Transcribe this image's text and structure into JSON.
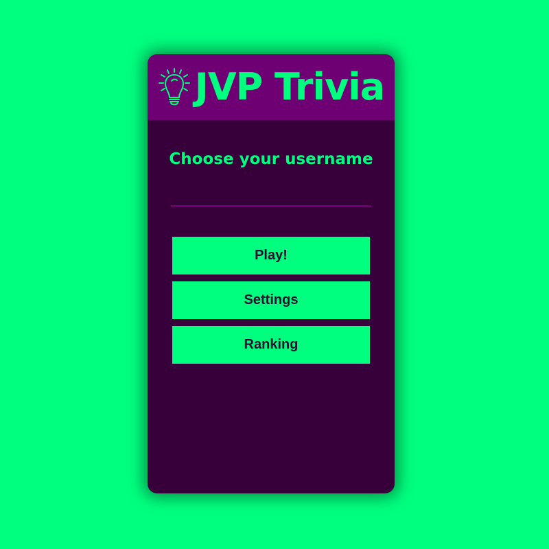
{
  "app": {
    "title": "JVP Trivia",
    "logo_icon": "lightbulb-icon"
  },
  "login": {
    "prompt": "Choose your username",
    "username_value": "",
    "username_placeholder": ""
  },
  "menu": {
    "play_label": "Play!",
    "settings_label": "Settings",
    "ranking_label": "Ranking"
  },
  "colors": {
    "background": "#00ff7f",
    "card": "#38003a",
    "header": "#6e0073",
    "accent": "#00ff7f",
    "button_text": "#2a1030"
  }
}
